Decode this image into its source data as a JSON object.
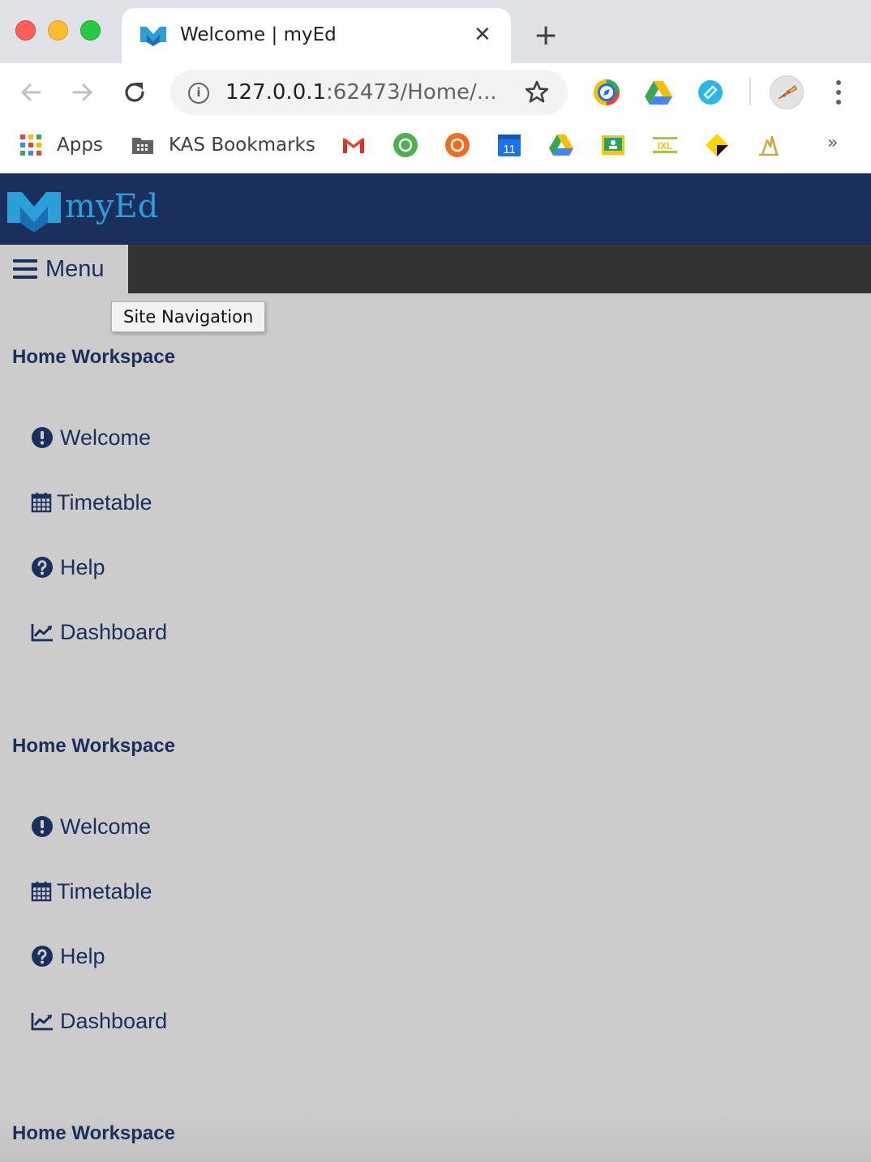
{
  "browser": {
    "tab_title": "Welcome | myEd",
    "tab_close": "✕",
    "new_tab": "+",
    "url_host": "127.0.0.1",
    "url_rest": ":62473/Home/...",
    "bookmarks": {
      "apps_label": "Apps",
      "folder_label": "KAS Bookmarks",
      "more": "»"
    }
  },
  "site": {
    "logo_text": "myEd",
    "menu_label": "Menu",
    "tooltip": "Site Navigation",
    "colors": {
      "header": "#1b2f5d",
      "menubar": "#333333",
      "page": "#cccccc",
      "accent": "#2a9fd8"
    }
  },
  "sections": [
    {
      "title": "Home Workspace",
      "items": [
        {
          "label": "Welcome",
          "icon": "exclamation-circle-icon"
        },
        {
          "label": "Timetable",
          "icon": "calendar-icon"
        },
        {
          "label": "Help",
          "icon": "question-circle-icon"
        },
        {
          "label": "Dashboard",
          "icon": "line-chart-icon"
        }
      ]
    },
    {
      "title": "Home Workspace",
      "items": [
        {
          "label": "Welcome",
          "icon": "exclamation-circle-icon"
        },
        {
          "label": "Timetable",
          "icon": "calendar-icon"
        },
        {
          "label": "Help",
          "icon": "question-circle-icon"
        },
        {
          "label": "Dashboard",
          "icon": "line-chart-icon"
        }
      ]
    },
    {
      "title": "Home Workspace",
      "items": []
    }
  ]
}
